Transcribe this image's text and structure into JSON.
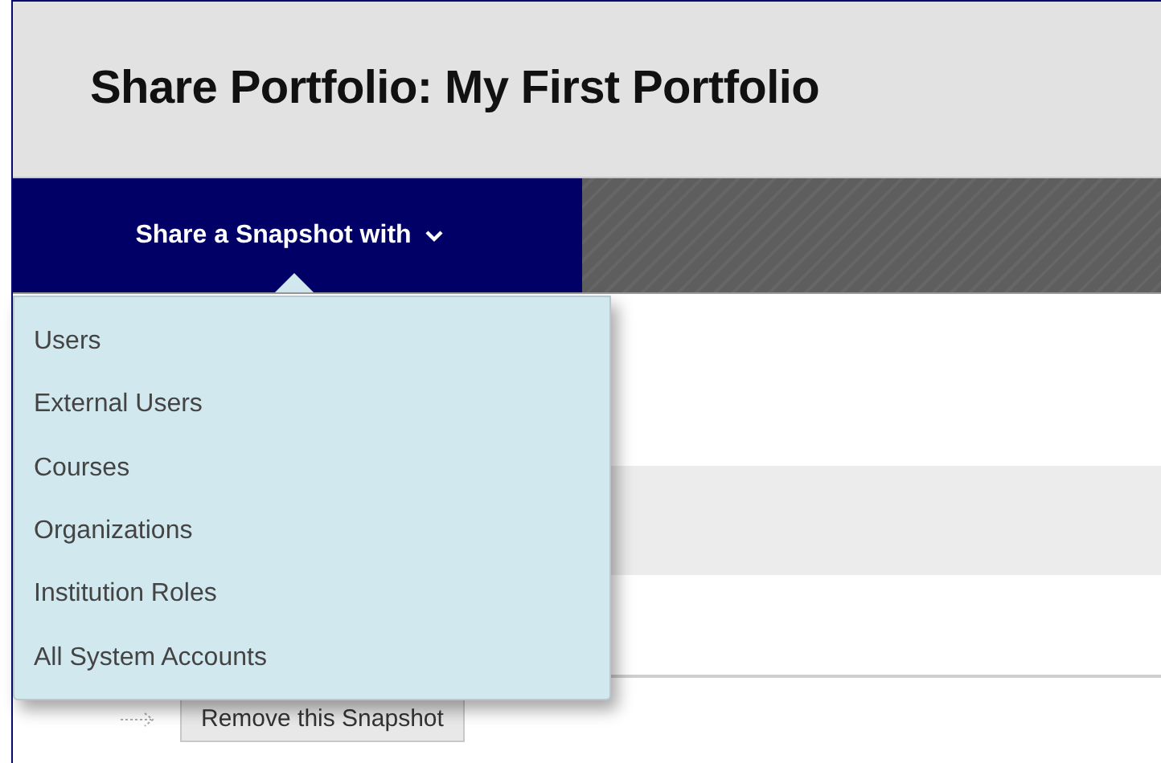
{
  "title": "Share Portfolio: My First Portfolio",
  "share_menu": {
    "label": "Share a Snapshot with",
    "expanded": true,
    "items": [
      {
        "label": "Users"
      },
      {
        "label": "External Users"
      },
      {
        "label": "Courses"
      },
      {
        "label": "Organizations"
      },
      {
        "label": "Institution Roles"
      },
      {
        "label": "All System Accounts"
      }
    ]
  },
  "remove_button": "Remove this Snapshot"
}
